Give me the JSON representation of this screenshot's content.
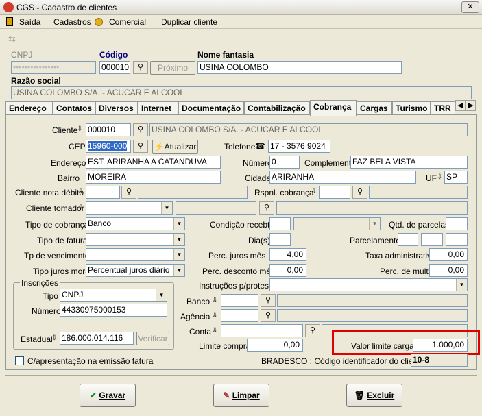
{
  "window": {
    "title": "CGS - Cadastro de clientes",
    "close": "✕"
  },
  "menu": {
    "saida": "Saída",
    "cadastros": "Cadastros",
    "comercial": "Comercial",
    "duplicar": "Duplicar cliente"
  },
  "header": {
    "cnpj_label": "CNPJ",
    "codigo_label": "Código",
    "codigo_value": "000010",
    "proximo_label": "Próximo",
    "nome_fantasia_label": "Nome fantasia",
    "nome_fantasia_value": "USINA COLOMBO",
    "razao_label": "Razão social",
    "razao_value": "USINA COLOMBO S/A. - ACUCAR E ALCOOL"
  },
  "tabs": [
    "Endereço",
    "Contatos",
    "Diversos",
    "Internet",
    "Documentação",
    "Contabilização",
    "Cobrança",
    "Cargas",
    "Turismo",
    "TRR"
  ],
  "form": {
    "cliente_label": "Cliente",
    "cliente_code": "000010",
    "cliente_name": "USINA COLOMBO S/A. - ACUCAR E ALCOOL",
    "cep_label": "CEP",
    "cep_value": "15960-000",
    "atualizar": "Atualizar",
    "telefone_label": "Telefone",
    "telefone_value": "17 - 3576 9024",
    "endereco_label": "Endereço",
    "endereco_value": "EST. ARIRANHA A CATANDUVA",
    "numero_label": "Número",
    "numero_value": "0",
    "complemento_label": "Complemento",
    "complemento_value": "FAZ BELA VISTA",
    "bairro_label": "Bairro",
    "bairro_value": "MOREIRA",
    "cidade_label": "Cidade",
    "cidade_value": "ARIRANHA",
    "uf_label": "UF",
    "uf_value": "SP",
    "cliente_nota_label": "Cliente nota débito",
    "rspnl_label": "Rspnl. cobrança",
    "cliente_tomador_label": "Cliente tomador",
    "tipo_cobranca_label": "Tipo de cobrança",
    "tipo_cobranca_value": "Banco",
    "condicao_label": "Condição recebto",
    "qtd_parcelas_label": "Qtd. de parcelas",
    "tipo_fatura_label": "Tipo de fatura",
    "dias_label": "Dia(s)",
    "parcelamento_label": "Parcelamento",
    "tp_venc_label": "Tp de vencimento",
    "perc_juros_label": "Perc. juros mês",
    "perc_juros_value": "4,00",
    "taxa_adm_label": "Taxa administrativa",
    "taxa_adm_value": "0,00",
    "tipo_juros_label": "Tipo juros mora",
    "tipo_juros_value": "Percentual juros diário",
    "perc_desc_label": "Perc. desconto mês",
    "perc_desc_value": "0,00",
    "perc_multa_label": "Perc. de multa",
    "perc_multa_value": "0,00",
    "inscricoes_label": "Inscrições",
    "tipo_label": "Tipo",
    "tipo_value": "CNPJ",
    "numero_insc_label": "Número",
    "numero_insc_value": "44330975000153",
    "estadual_label": "Estadual",
    "estadual_value": "186.000.014.116",
    "verificar": "Verificar",
    "instrucoes_label": "Instruções p/protesto",
    "banco_label": "Banco",
    "agencia_label": "Agência",
    "conta_label": "Conta",
    "limite_compra_label": "Limite compra",
    "limite_compra_value": "0,00",
    "valor_limite_label": "Valor limite cargas",
    "valor_limite_value": "1.000,00",
    "capresentacao_label": "C/apresentação na emissão fatura",
    "bradesco_label": "BRADESCO : Código identificador do cliente",
    "bradesco_value": "10-8"
  },
  "buttons": {
    "gravar": "Gravar",
    "limpar": "Limpar",
    "excluir": "Excluir"
  }
}
